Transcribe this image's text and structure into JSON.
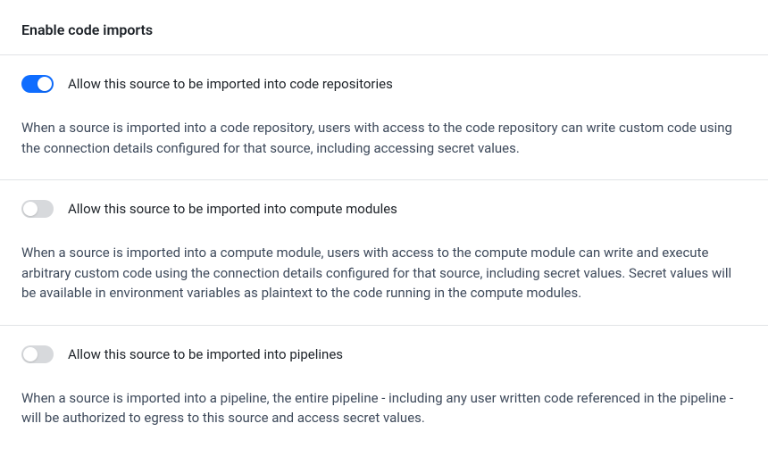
{
  "header": {
    "title": "Enable code imports"
  },
  "settings": [
    {
      "label": "Allow this source to be imported into code repositories",
      "description": "When a source is imported into a code repository, users with access to the code repository can write custom code using the connection details configured for that source, including accessing secret values.",
      "enabled": true
    },
    {
      "label": "Allow this source to be imported into compute modules",
      "description": "When a source is imported into a compute module, users with access to the compute module can write and execute arbitrary custom code using the connection details configured for that source, including secret values. Secret values will be available in environment variables as plaintext to the code running in the compute modules.",
      "enabled": false
    },
    {
      "label": "Allow this source to be imported into pipelines",
      "description": "When a source is imported into a pipeline, the entire pipeline - including any user written code referenced in the pipeline - will be authorized to egress to this source and access secret values.",
      "enabled": false
    }
  ]
}
